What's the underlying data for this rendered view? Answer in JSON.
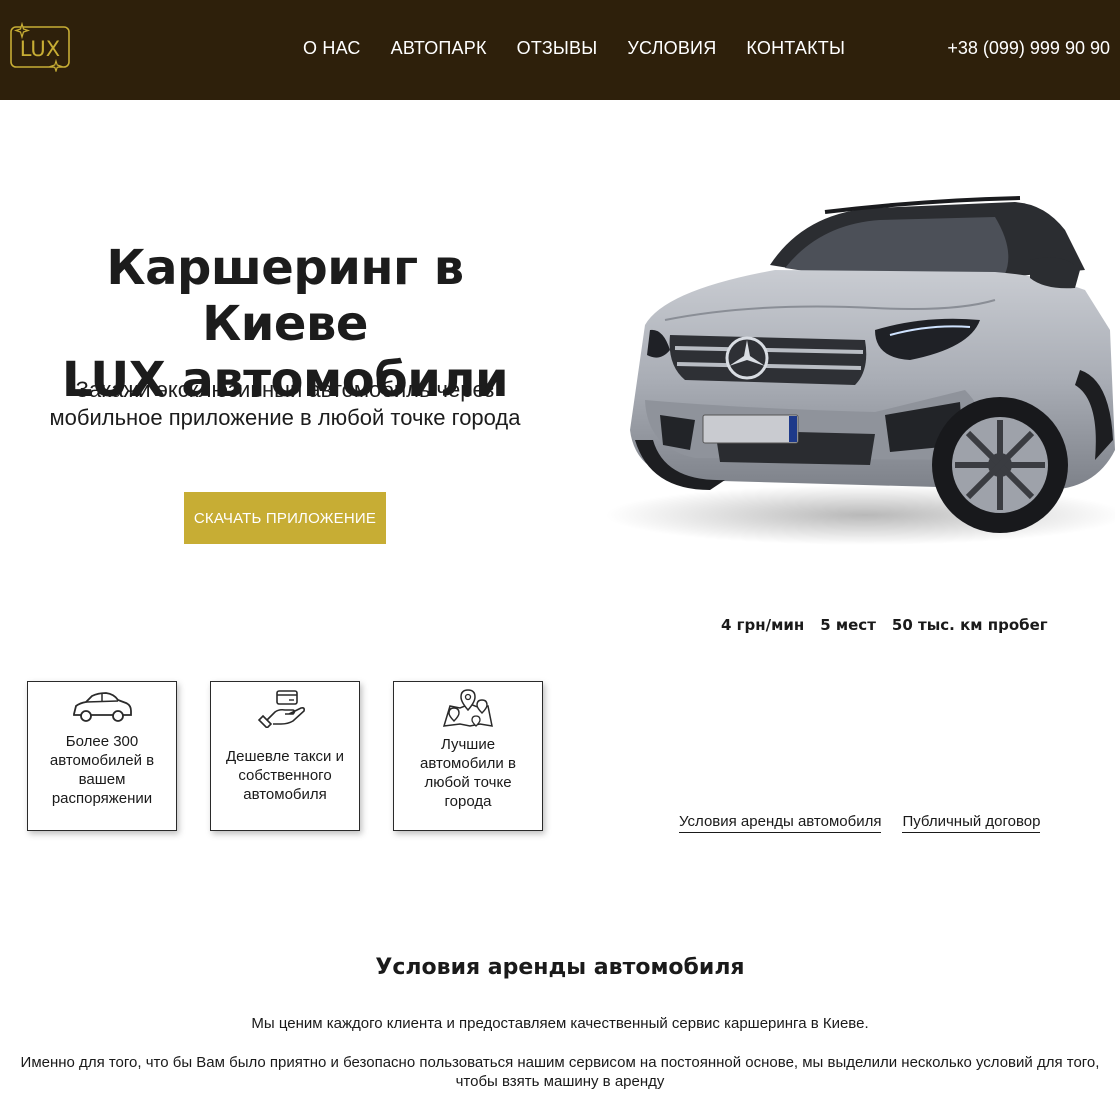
{
  "header": {
    "logo_text": "LUX",
    "nav": [
      "О НАС",
      "АВТОПАРК",
      "ОТЗЫВЫ",
      "УСЛОВИЯ",
      "КОНТАКТЫ"
    ],
    "phone": "+38 (099) 999 90 90"
  },
  "hero": {
    "title_line1": "Каршеринг в Киеве",
    "title_line2": "LUX автомобили",
    "subtitle_line1": "Закажи эксклюзивный автомобиль через",
    "subtitle_line2": "мобильное приложение в любой точке города",
    "cta_label": "СКАЧАТЬ ПРИЛОЖЕНИЕ"
  },
  "car": {
    "specs": [
      "4 грн/мин",
      "5 мест",
      "50 тыс. км пробег"
    ]
  },
  "features": [
    {
      "icon": "car-icon",
      "text": "Более 300 автомобилей в вашем распоряжении"
    },
    {
      "icon": "card-in-hand-icon",
      "text": "Дешевле такси и собственного автомобиля"
    },
    {
      "icon": "map-pins-icon",
      "text": "Лучшие автомобили в любой точке города"
    }
  ],
  "links": [
    "Условия аренды автомобиля",
    "Публичный договор"
  ],
  "conditions": {
    "title": "Условия аренды автомобиля",
    "p1": "Мы ценим каждого клиента и предоставляем качественный сервис каршеринга в Киеве.",
    "p2": "Именно для того, что бы Вам было приятно и безопасно пользоваться нашим сервисом на постоянной основе, мы выделили несколько условий для того, чтобы взять машину в аренду"
  },
  "colors": {
    "header_bg": "#2e200b",
    "accent_gold": "#c7ad34",
    "text": "#1a1a1a"
  }
}
